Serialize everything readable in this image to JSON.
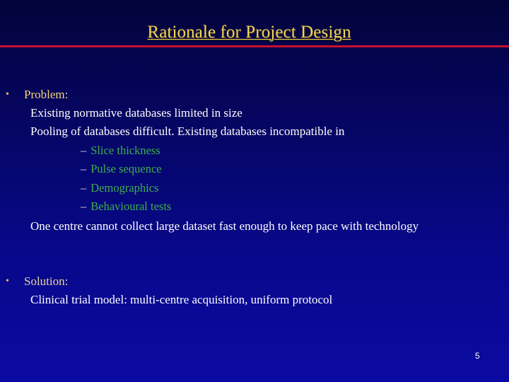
{
  "slide": {
    "title": "Rationale for Project Design",
    "page_number": "5",
    "colors": {
      "title": "#f2d458",
      "title_rule": "#c8102e",
      "background_top": "#03033a",
      "background_bottom": "#0a0aa2",
      "body_text": "#ffffff",
      "sub_bullet_text": "#3cb04a",
      "bullet_marker": "#e8c050"
    }
  },
  "problem": {
    "bullet_icon": "•",
    "heading": "Problem:",
    "lines": [
      "Existing normative databases limited in size",
      "Pooling of databases difficult. Existing databases incompatible in"
    ],
    "sub_bullets": [
      {
        "dash": "–",
        "text": "Slice thickness"
      },
      {
        "dash": "–",
        "text": "Pulse sequence"
      },
      {
        "dash": "–",
        "text": "Demographics"
      },
      {
        "dash": "–",
        "text": "Behavioural tests"
      }
    ],
    "closing_line": "One centre cannot collect large dataset fast enough to keep pace with technology"
  },
  "solution": {
    "bullet_icon": "•",
    "heading": "Solution:",
    "lines": [
      "Clinical trial model: multi-centre acquisition, uniform protocol"
    ]
  }
}
